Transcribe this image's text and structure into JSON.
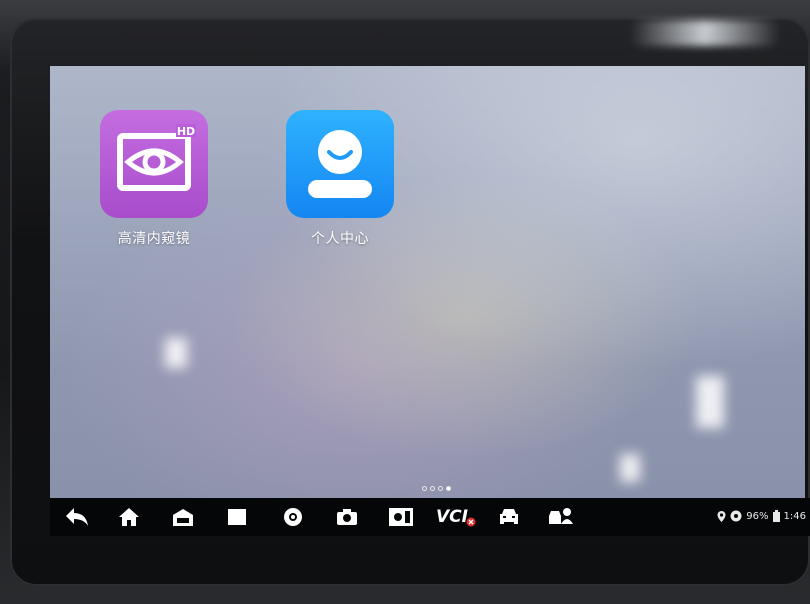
{
  "apps": [
    {
      "label": "高清内窥镜",
      "icon": "endoscope-eye-icon",
      "badge": "HD",
      "color": "#b95ed8"
    },
    {
      "label": "个人中心",
      "icon": "user-profile-icon",
      "color": "#1f9cfb"
    }
  ],
  "pager": {
    "pages": 4,
    "current": 4
  },
  "navbar": {
    "buttons": [
      {
        "name": "back-icon"
      },
      {
        "name": "home-icon"
      },
      {
        "name": "car-garage-icon"
      },
      {
        "name": "recent-apps-icon"
      },
      {
        "name": "browser-icon"
      },
      {
        "name": "camera-icon"
      },
      {
        "name": "screen-brightness-icon"
      },
      {
        "name": "vci-status-icon",
        "text": "VCI"
      },
      {
        "name": "vehicle-diagnosis-icon"
      },
      {
        "name": "vehicle-technician-icon"
      }
    ]
  },
  "status": {
    "battery": "96%",
    "time": "1:46"
  }
}
